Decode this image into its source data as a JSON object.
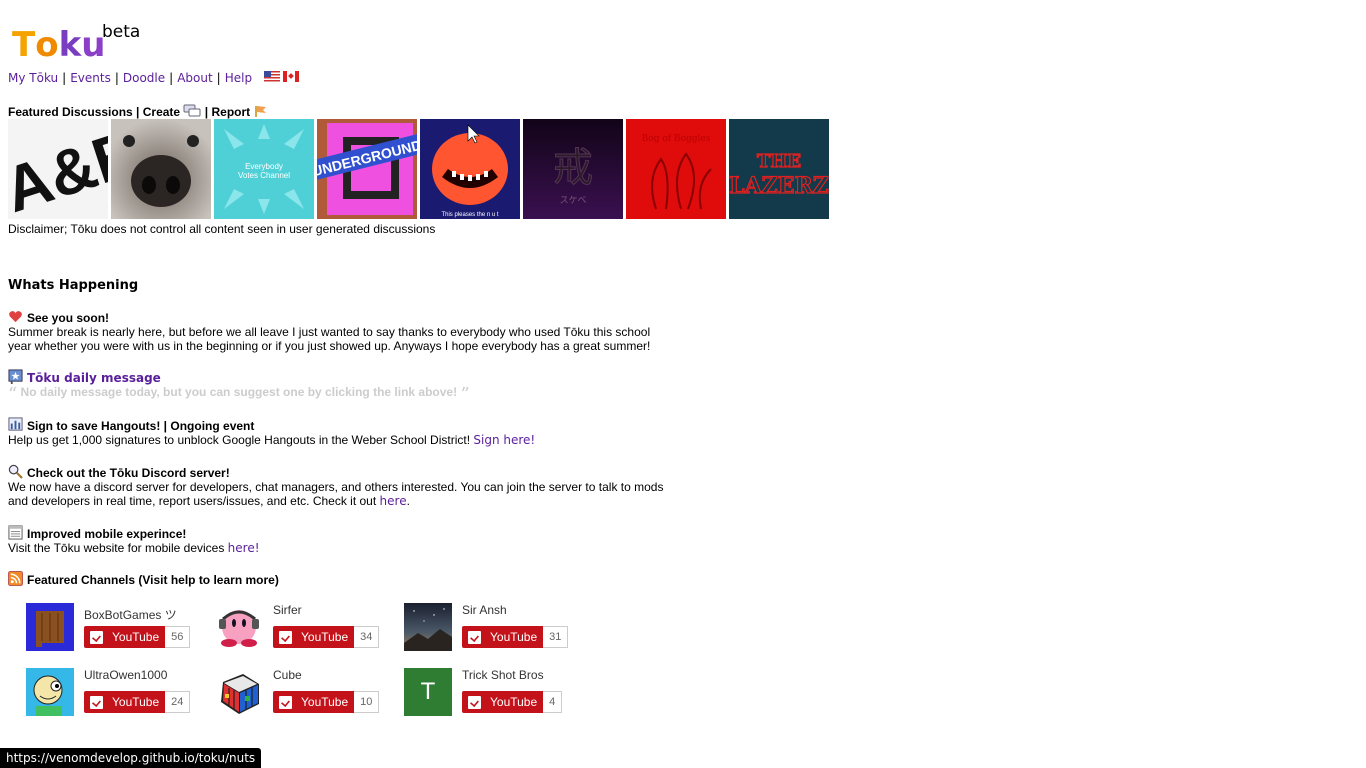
{
  "logo": {
    "letters": [
      "T",
      "o",
      "k",
      "u"
    ],
    "colors": [
      "#f0a000",
      "#f08000",
      "#7a3cc0",
      "#8c40c8"
    ],
    "beta": "beta"
  },
  "nav": {
    "items": [
      "My Tōku",
      "Events",
      "Doodle",
      "About",
      "Help"
    ],
    "flags": [
      "us-flag-icon",
      "canada-flag-icon"
    ]
  },
  "featured": {
    "title": "Featured Discussions",
    "create": "Create",
    "report": "Report"
  },
  "thumbnails": [
    "A&E",
    "dog nose",
    "Everybody Votes Channel",
    "UNDERGROUND",
    "This pleases the n u t",
    "スケベ",
    "Bog of Boggles",
    "THE LAZERZ"
  ],
  "disclaimer": "Disclaimer; Tōku does not control all content seen in user generated discussions",
  "whats_happening": "Whats Happening",
  "items": {
    "see_you": {
      "title": "See you soon!",
      "body": "Summer break is nearly here, but before we all leave I just wanted to say thanks to everybody who used Tōku this school year whether you were with us in the beginning or if you just showed up. Anyways I hope everybody has a great summer!"
    },
    "daily": {
      "title": "Tōku daily message",
      "quote": "No daily message today, but you can suggest one by clicking the link above!"
    },
    "hangouts": {
      "title": "Sign to save Hangouts! | Ongoing event",
      "body": "Help us get 1,000 signatures to unblock Google Hangouts in the Weber School District!",
      "link": "Sign here!"
    },
    "discord": {
      "title": "Check out the Tōku Discord server!",
      "body": "We now have a discord server for developers, chat managers, and others interested. You can join the server to talk to mods and developers in real time, report users/issues, and etc. Check it out",
      "link": "here",
      "end": "."
    },
    "mobile": {
      "title": "Improved mobile experince!",
      "body": "Visit the Tōku website for mobile devices",
      "link": "here!"
    },
    "channels_title": "Featured Channels (Visit help to learn more)"
  },
  "channels": [
    {
      "name": "BoxBotGames ツ",
      "count": "56"
    },
    {
      "name": "Sirfer",
      "count": "34"
    },
    {
      "name": "Sir Ansh",
      "count": "31"
    },
    {
      "name": "UltraOwen1000",
      "count": "24"
    },
    {
      "name": "Cube",
      "count": "10"
    },
    {
      "name": "Trick Shot Bros",
      "count": "4",
      "initial": "T"
    }
  ],
  "youtube_label": "YouTube",
  "status_url": "https://venomdevelop.github.io/toku/nuts"
}
